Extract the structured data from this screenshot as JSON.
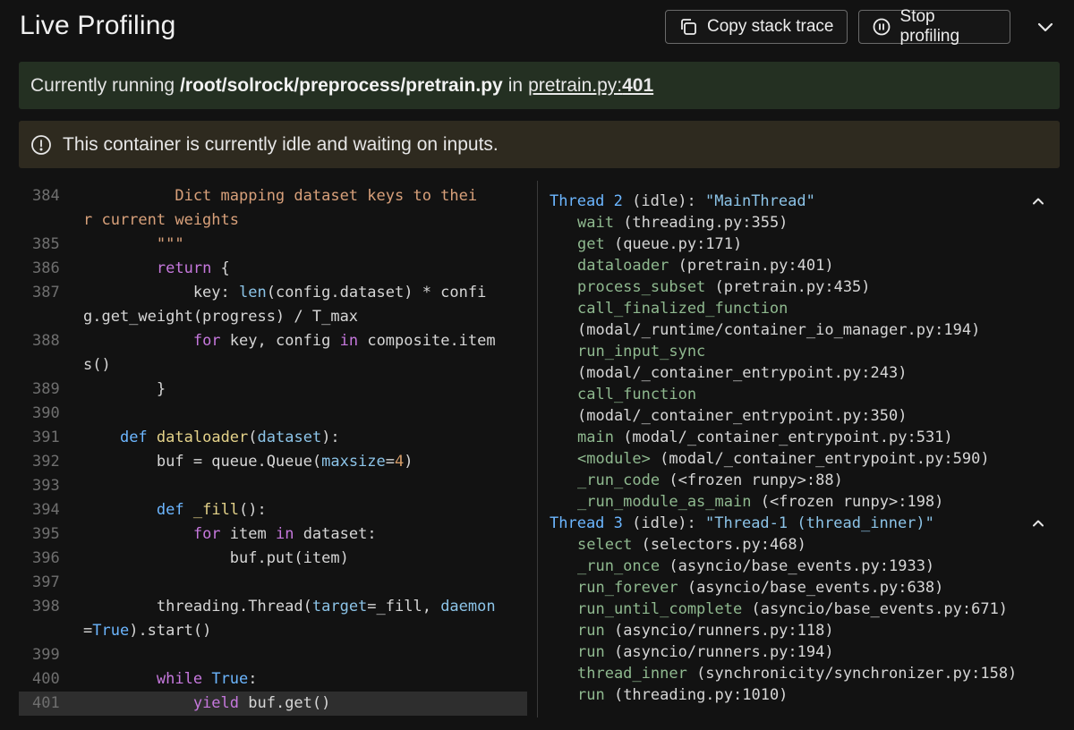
{
  "header": {
    "title": "Live Profiling",
    "copy_label": "Copy stack trace",
    "stop_label": "Stop profiling"
  },
  "running": {
    "prefix": "Currently running",
    "path": "/root/solrock/preprocess/pretrain.py",
    "in_text": "in",
    "file": "pretrain.py:",
    "line": "401"
  },
  "idle": {
    "message": "This container is currently idle and waiting on inputs."
  },
  "code": {
    "lines": [
      {
        "num": "384",
        "tokens": [
          [
            "str",
            "          Dict mapping dataset keys to thei"
          ]
        ]
      },
      {
        "num": "",
        "tokens": [
          [
            "str",
            "r current weights"
          ]
        ]
      },
      {
        "num": "385",
        "tokens": [
          [
            "str",
            "        \"\"\""
          ]
        ]
      },
      {
        "num": "386",
        "tokens": [
          [
            "",
            "        "
          ],
          [
            "kw",
            "return"
          ],
          [
            "",
            " {"
          ]
        ]
      },
      {
        "num": "387",
        "tokens": [
          [
            "",
            "            key: "
          ],
          [
            "bi",
            "len"
          ],
          [
            "",
            "(config.dataset) * confi"
          ]
        ]
      },
      {
        "num": "",
        "tokens": [
          [
            "",
            "g.get_weight(progress) / T_max"
          ]
        ]
      },
      {
        "num": "388",
        "tokens": [
          [
            "",
            "            "
          ],
          [
            "kw",
            "for"
          ],
          [
            "",
            " key, config "
          ],
          [
            "kw",
            "in"
          ],
          [
            "",
            " composite.item"
          ]
        ]
      },
      {
        "num": "",
        "tokens": [
          [
            "",
            "s()"
          ]
        ]
      },
      {
        "num": "389",
        "tokens": [
          [
            "",
            "        }"
          ]
        ]
      },
      {
        "num": "390",
        "tokens": [
          [
            "",
            ""
          ]
        ]
      },
      {
        "num": "391",
        "tokens": [
          [
            "",
            "    "
          ],
          [
            "const",
            "def"
          ],
          [
            "",
            " "
          ],
          [
            "fn",
            "dataloader"
          ],
          [
            "",
            "("
          ],
          [
            "bi",
            "dataset"
          ],
          [
            "",
            "):"
          ]
        ]
      },
      {
        "num": "392",
        "tokens": [
          [
            "",
            "        buf = queue.Queue("
          ],
          [
            "bi",
            "maxsize"
          ],
          [
            "",
            "="
          ],
          [
            "num",
            "4"
          ],
          [
            "",
            ")"
          ]
        ]
      },
      {
        "num": "393",
        "tokens": [
          [
            "",
            ""
          ]
        ]
      },
      {
        "num": "394",
        "tokens": [
          [
            "",
            "        "
          ],
          [
            "const",
            "def"
          ],
          [
            "",
            " "
          ],
          [
            "fn",
            "_fill"
          ],
          [
            "",
            "():"
          ]
        ]
      },
      {
        "num": "395",
        "tokens": [
          [
            "",
            "            "
          ],
          [
            "kw",
            "for"
          ],
          [
            "",
            " item "
          ],
          [
            "kw",
            "in"
          ],
          [
            "",
            " dataset:"
          ]
        ]
      },
      {
        "num": "396",
        "tokens": [
          [
            "",
            "                buf.put(item)"
          ]
        ]
      },
      {
        "num": "397",
        "tokens": [
          [
            "",
            ""
          ]
        ]
      },
      {
        "num": "398",
        "tokens": [
          [
            "",
            "        threading.Thread("
          ],
          [
            "bi",
            "target"
          ],
          [
            "",
            "=_fill, "
          ],
          [
            "bi",
            "daemon"
          ]
        ]
      },
      {
        "num": "",
        "tokens": [
          [
            "",
            "="
          ],
          [
            "const",
            "True"
          ],
          [
            "",
            ").start()"
          ]
        ]
      },
      {
        "num": "399",
        "tokens": [
          [
            "",
            ""
          ]
        ]
      },
      {
        "num": "400",
        "tokens": [
          [
            "",
            "        "
          ],
          [
            "kw",
            "while"
          ],
          [
            "",
            " "
          ],
          [
            "const",
            "True"
          ],
          [
            "",
            ":"
          ]
        ]
      },
      {
        "num": "401",
        "current": true,
        "tokens": [
          [
            "",
            "            "
          ],
          [
            "kw",
            "yield"
          ],
          [
            "",
            " buf.get()"
          ]
        ]
      }
    ]
  },
  "threads": [
    {
      "name": "Thread 2",
      "state": " (idle): ",
      "label": "\"MainThread\"",
      "frames": [
        {
          "fn": "wait",
          "loc": " (threading.py:355)"
        },
        {
          "fn": "get",
          "loc": " (queue.py:171)"
        },
        {
          "fn": "dataloader",
          "loc": " (pretrain.py:401)"
        },
        {
          "fn": "process_subset",
          "loc": " (pretrain.py:435)"
        },
        {
          "fn": "call_finalized_function",
          "loc": ""
        },
        {
          "fn": "",
          "loc": "(modal/_runtime/container_io_manager.py:194)"
        },
        {
          "fn": "run_input_sync",
          "loc": ""
        },
        {
          "fn": "",
          "loc": "(modal/_container_entrypoint.py:243)"
        },
        {
          "fn": "call_function",
          "loc": ""
        },
        {
          "fn": "",
          "loc": "(modal/_container_entrypoint.py:350)"
        },
        {
          "fn": "main",
          "loc": " (modal/_container_entrypoint.py:531)"
        },
        {
          "fn": "<module>",
          "loc": " (modal/_container_entrypoint.py:590)"
        },
        {
          "fn": "_run_code",
          "loc": " (<frozen runpy>:88)"
        },
        {
          "fn": "_run_module_as_main",
          "loc": " (<frozen runpy>:198)"
        }
      ]
    },
    {
      "name": "Thread 3",
      "state": " (idle): ",
      "label": "\"Thread-1 (thread_inner)\"",
      "frames": [
        {
          "fn": "select",
          "loc": " (selectors.py:468)"
        },
        {
          "fn": "_run_once",
          "loc": " (asyncio/base_events.py:1933)"
        },
        {
          "fn": "run_forever",
          "loc": " (asyncio/base_events.py:638)"
        },
        {
          "fn": "run_until_complete",
          "loc": " (asyncio/base_events.py:671)"
        },
        {
          "fn": "run",
          "loc": " (asyncio/runners.py:118)"
        },
        {
          "fn": "run",
          "loc": " (asyncio/runners.py:194)"
        },
        {
          "fn": "thread_inner",
          "loc": " (synchronicity/synchronizer.py:158)"
        },
        {
          "fn": "run",
          "loc": " (threading.py:1010)"
        }
      ]
    }
  ]
}
